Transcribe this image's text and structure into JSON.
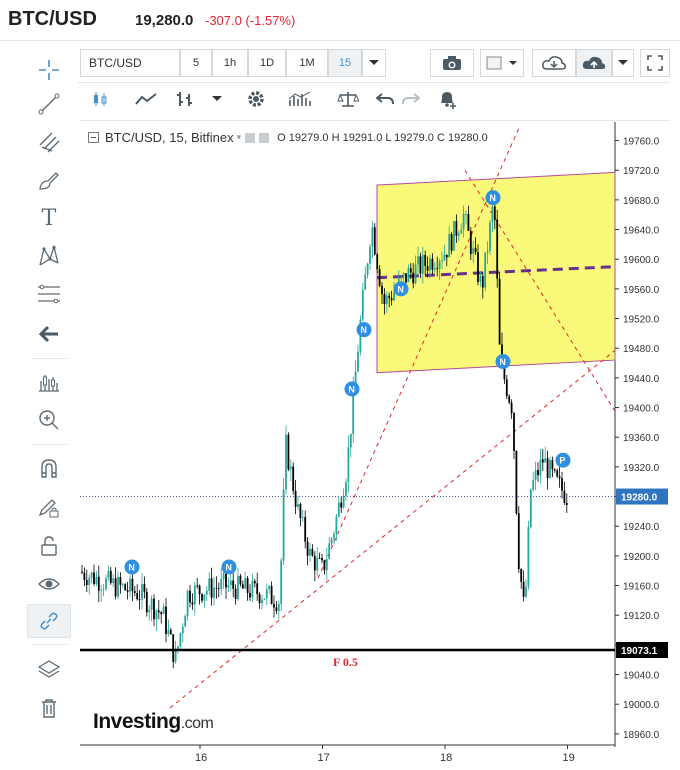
{
  "header": {
    "symbol": "BTC/USD",
    "price": "19,280.0",
    "change": "-307.0 (-1.57%)"
  },
  "toolbar": {
    "symbol_input": "BTC/USD",
    "intervals": [
      "5",
      "1h",
      "1D",
      "1M",
      "15"
    ],
    "selected_interval": "15"
  },
  "left_tools": [
    {
      "name": "crosshair-icon",
      "glyph": "crosshair"
    },
    {
      "name": "trend-line-icon",
      "glyph": "line"
    },
    {
      "name": "fork-icon",
      "glyph": "fork"
    },
    {
      "name": "brush-icon",
      "glyph": "brush"
    },
    {
      "name": "text-icon",
      "glyph": "T"
    },
    {
      "name": "pattern-icon",
      "glyph": "pattern"
    },
    {
      "name": "fibonacci-icon",
      "glyph": "fib"
    },
    {
      "name": "arrow-left-icon",
      "glyph": "←"
    },
    {
      "name": "measure-icon",
      "glyph": "measure"
    },
    {
      "name": "zoom-in-icon",
      "glyph": "zoom"
    },
    {
      "name": "magnet-icon",
      "glyph": "magnet"
    },
    {
      "name": "pencil-lock-icon",
      "glyph": "pencil"
    },
    {
      "name": "lock-icon",
      "glyph": "lock"
    },
    {
      "name": "eye-icon",
      "glyph": "eye"
    },
    {
      "name": "link-icon",
      "glyph": "link"
    },
    {
      "name": "layers-icon",
      "glyph": "layers"
    },
    {
      "name": "trash-icon",
      "glyph": "trash"
    }
  ],
  "legend": {
    "title": "BTC/USD, 15, Bitfinex",
    "ohlc": "O 19279.0  H 19291.0  L 19279.0  C 19280.0"
  },
  "chart_data": {
    "type": "candlestick",
    "x_ticks": [
      "16",
      "17",
      "18",
      "19"
    ],
    "y_ticks": [
      "19760.0",
      "19720.0",
      "19680.0",
      "19640.0",
      "19600.0",
      "19560.0",
      "19520.0",
      "19480.0",
      "19440.0",
      "19400.0",
      "19360.0",
      "19320.0",
      "19280.0",
      "19240.0",
      "19200.0",
      "19160.0",
      "19120.0",
      "19080.0",
      "19040.0",
      "19000.0",
      "18960.0"
    ],
    "ylim": [
      18945,
      19785
    ],
    "current_price_label": "19280.0",
    "current_price": 19280,
    "fib_line_label": "19073.1",
    "fib_line_value": 19073.1,
    "fib_text": "F 0.5",
    "channel_color": "#fbf97a",
    "up_color": "#26a69a",
    "down_color": "#000000",
    "markers": [
      "N",
      "N",
      "N",
      "N",
      "N",
      "N",
      "N",
      "P"
    ],
    "approx_path": [
      [
        15.0,
        19180
      ],
      [
        15.3,
        19160
      ],
      [
        15.5,
        19150
      ],
      [
        15.7,
        19120
      ],
      [
        15.8,
        19060
      ],
      [
        15.9,
        19150
      ],
      [
        16.2,
        19160
      ],
      [
        16.5,
        19150
      ],
      [
        16.65,
        19140
      ],
      [
        16.7,
        19350
      ],
      [
        16.8,
        19260
      ],
      [
        16.9,
        19200
      ],
      [
        17.0,
        19180
      ],
      [
        17.1,
        19240
      ],
      [
        17.2,
        19320
      ],
      [
        17.3,
        19500
      ],
      [
        17.4,
        19650
      ],
      [
        17.5,
        19540
      ],
      [
        17.7,
        19580
      ],
      [
        17.9,
        19600
      ],
      [
        18.0,
        19610
      ],
      [
        18.15,
        19660
      ],
      [
        18.3,
        19560
      ],
      [
        18.4,
        19680
      ],
      [
        18.45,
        19460
      ],
      [
        18.55,
        19400
      ],
      [
        18.6,
        19200
      ],
      [
        18.65,
        19120
      ],
      [
        18.7,
        19290
      ],
      [
        18.8,
        19330
      ],
      [
        18.9,
        19300
      ],
      [
        19.0,
        19280
      ]
    ]
  }
}
